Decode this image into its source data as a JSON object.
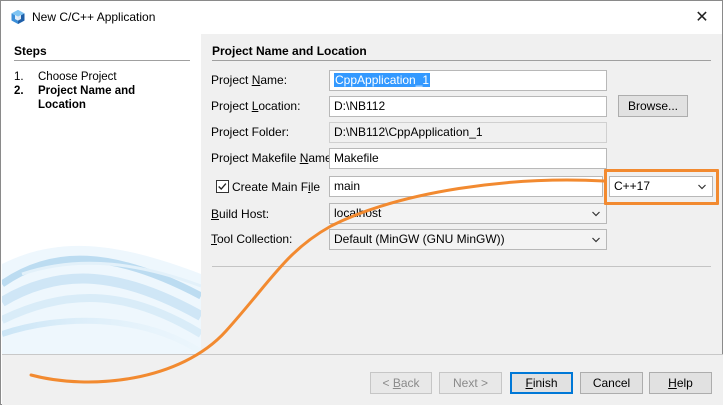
{
  "window": {
    "title": "New C/C++ Application",
    "close_glyph": "✕"
  },
  "steps": {
    "heading": "Steps",
    "items": [
      {
        "num": "1.",
        "label": "Choose Project",
        "current": false
      },
      {
        "num": "2.",
        "label": "Project Name and Location",
        "current": true
      }
    ]
  },
  "content": {
    "heading": "Project Name and Location",
    "project_name": {
      "label": "Project Name:",
      "value": "CppApplication_1"
    },
    "project_location": {
      "label": "Project Location:",
      "value": "D:\\NB112",
      "button": "Browse..."
    },
    "project_folder": {
      "label": "Project Folder:",
      "value": "D:\\NB112\\CppApplication_1"
    },
    "makefile_name": {
      "label": "Project Makefile Name:",
      "value": "Makefile"
    },
    "main_file": {
      "label": "Create Main File",
      "checked": true,
      "value": "main",
      "language": "C++17"
    },
    "build_host": {
      "label": "Build Host:",
      "value": "localhost"
    },
    "tool_collection": {
      "label": "Tool Collection:",
      "value": "Default (MinGW (GNU MinGW))"
    }
  },
  "buttons": {
    "back": "< Back",
    "next": "Next >",
    "finish": "Finish",
    "cancel": "Cancel",
    "help": "Help"
  },
  "colors": {
    "annotation": "#f28a30",
    "selection": "#3399ff",
    "default_button_border": "#0078d7"
  },
  "icons": {
    "app": "netbeans-cube-icon",
    "checkbox": "checkmark-icon",
    "dropdown": "chevron-down-icon"
  }
}
